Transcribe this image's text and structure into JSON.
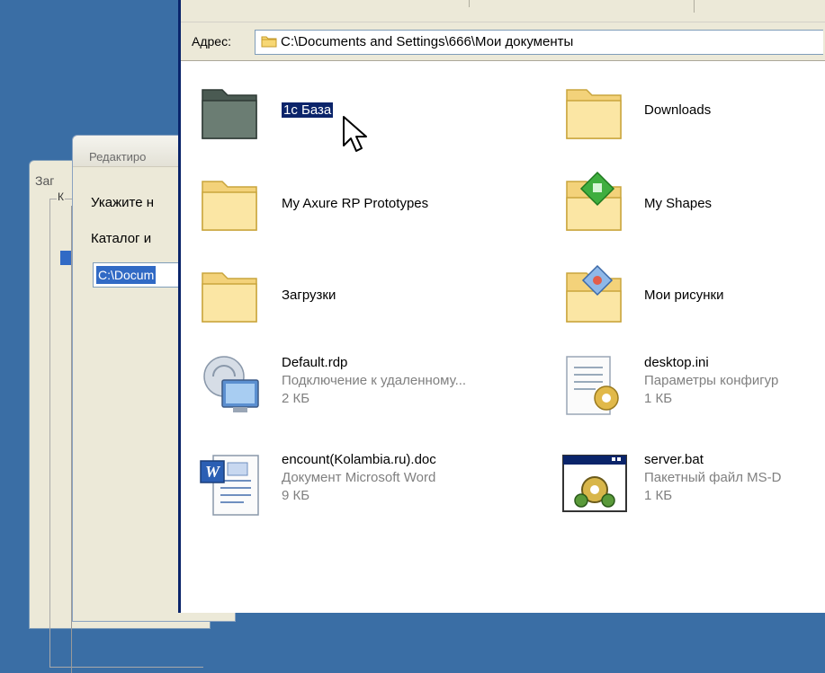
{
  "background_dialog": {
    "title": "Заг",
    "group_label": "К"
  },
  "edit_dialog": {
    "title": "Редактиро",
    "label_specify": "Укажите н",
    "label_catalog": "Каталог и",
    "path_value": "C:\\Docum"
  },
  "explorer": {
    "address_label": "Адрес:",
    "address_value": "C:\\Documents and Settings\\666\\Мои документы",
    "items": [
      {
        "name": "1с База",
        "icon": "dark-folder-icon",
        "selected": true
      },
      {
        "name": "Downloads",
        "icon": "folder-icon"
      },
      {
        "name": "My Axure RP Prototypes",
        "icon": "folder-icon"
      },
      {
        "name": "My Shapes",
        "icon": "shapes-folder-icon"
      },
      {
        "name": "Загрузки",
        "icon": "folder-icon"
      },
      {
        "name": "Мои рисунки",
        "icon": "pictures-folder-icon"
      },
      {
        "name": "Default.rdp",
        "type": "Подключение к удаленному...",
        "size": "2 КБ",
        "icon": "remote-desktop-icon"
      },
      {
        "name": "desktop.ini",
        "type": "Параметры конфигур",
        "size": "1 КБ",
        "icon": "config-file-icon"
      },
      {
        "name": "encount(Kolambia.ru).doc",
        "type": "Документ Microsoft Word",
        "size": "9 КБ",
        "icon": "word-document-icon"
      },
      {
        "name": "server.bat",
        "type": "Пакетный файл MS-D",
        "size": "1 КБ",
        "icon": "batch-file-icon"
      }
    ]
  },
  "colors": {
    "desktop": "#3a6ea5",
    "selection": "#0b246a",
    "dialog_bg": "#ece9d8"
  }
}
